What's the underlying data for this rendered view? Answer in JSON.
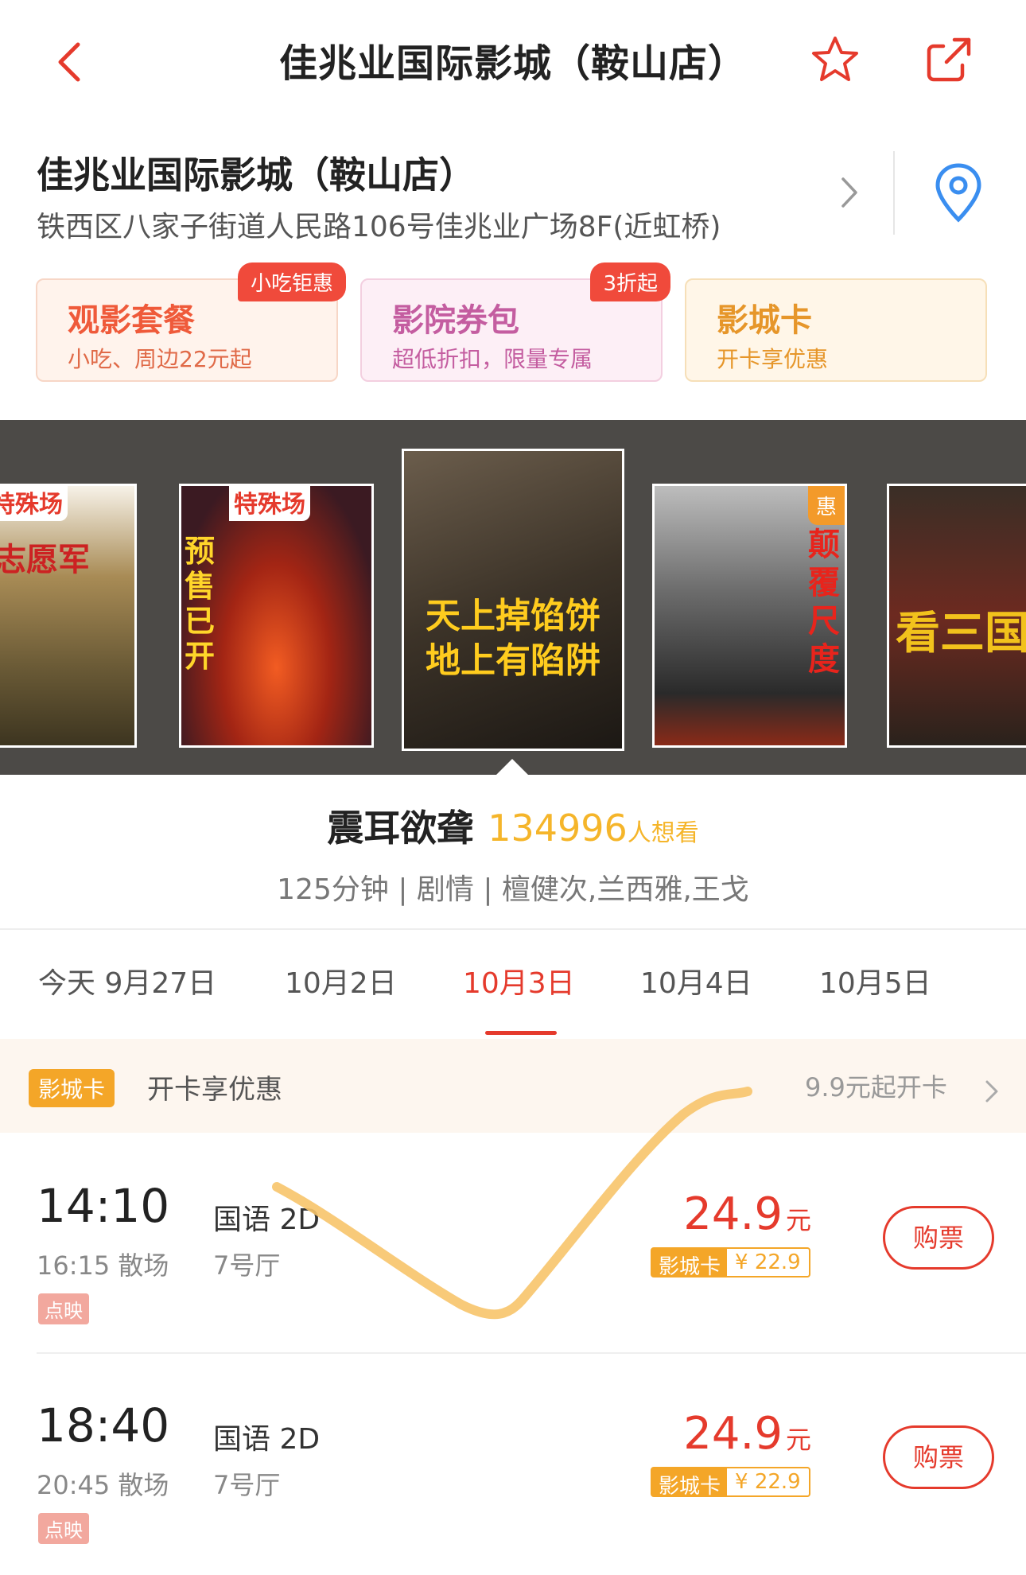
{
  "header": {
    "title": "佳兆业国际影城（鞍山店）"
  },
  "cinema": {
    "name": "佳兆业国际影城（鞍山店）",
    "address": "铁西区八家子街道人民路106号佳兆业广场8F(近虹桥)"
  },
  "promos": [
    {
      "title": "观影套餐",
      "subtitle": "小吃、周边22元起",
      "tag": "小吃钜惠"
    },
    {
      "title": "影院券包",
      "subtitle": "超低折扣，限量专属",
      "tag": "3折起"
    },
    {
      "title": "影城卡",
      "subtitle": "开卡享优惠"
    }
  ],
  "posters": [
    {
      "tag": "特殊场",
      "label": "志愿军"
    },
    {
      "tag": "特殊场",
      "label": "预售已开"
    },
    {
      "label": "天上掉馅饼 地上有陷阱"
    },
    {
      "tag": "惠",
      "label": "颠覆尺度"
    },
    {
      "label": "看三国"
    }
  ],
  "movie": {
    "title": "震耳欲聋",
    "want_count": "134996",
    "want_label": "人想看",
    "details": "125分钟 | 剧情 | 檀健次,兰西雅,王戈"
  },
  "dates": [
    {
      "label": "今天 9月27日",
      "active": false
    },
    {
      "label": "10月2日",
      "active": false
    },
    {
      "label": "10月3日",
      "active": true
    },
    {
      "label": "10月4日",
      "active": false
    },
    {
      "label": "10月5日",
      "active": false
    }
  ],
  "card_banner": {
    "badge": "影城卡",
    "text": "开卡享优惠",
    "right": "9.9元起开卡"
  },
  "showtimes": [
    {
      "start": "14:10",
      "end": "16:15 散场",
      "badge": "点映",
      "lang": "国语 2D",
      "hall": "7号厅",
      "price": "24.9",
      "price_unit": "元",
      "card_label": "影城卡",
      "card_price": "¥ 22.9",
      "buy": "购票"
    },
    {
      "start": "18:40",
      "end": "20:45 散场",
      "badge": "点映",
      "lang": "国语 2D",
      "hall": "7号厅",
      "price": "24.9",
      "price_unit": "元",
      "card_label": "影城卡",
      "card_price": "¥ 22.9",
      "buy": "购票"
    }
  ],
  "colors": {
    "accent": "#e53a2c",
    "gold": "#f5b52a",
    "card_orange": "#f4a628"
  }
}
